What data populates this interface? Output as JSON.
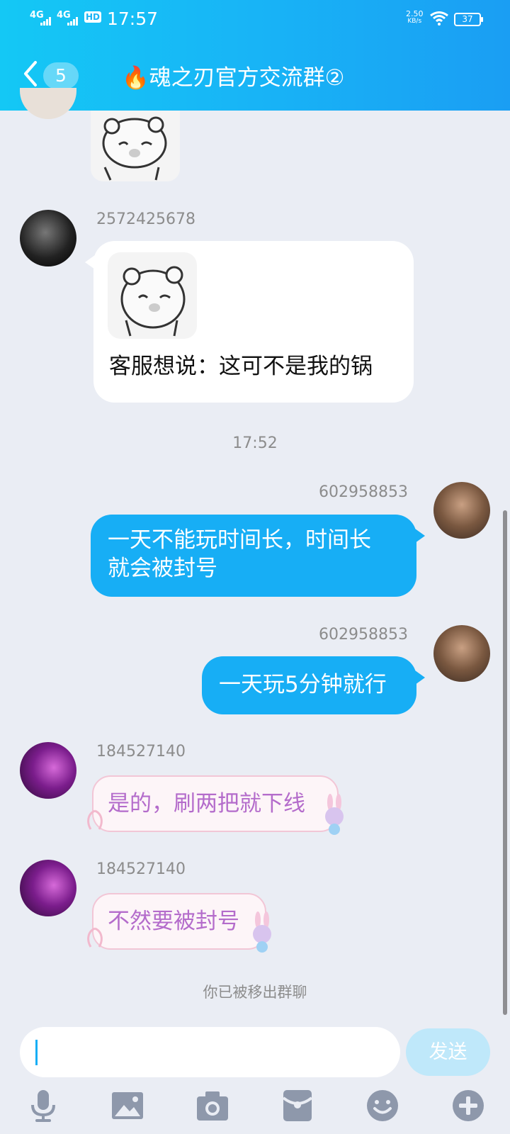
{
  "status_bar": {
    "signal1": "4G",
    "signal2": "4G",
    "hd": "HD",
    "time": "17:57",
    "net_speed": "2.50",
    "net_unit": "KB/s",
    "battery": "37"
  },
  "header": {
    "unread_count": "5",
    "title": "🔥魂之刃官方交流群②"
  },
  "messages": [
    {
      "sender": "2572425678",
      "text": "客服想说：这可不是我的锅"
    },
    {
      "timestamp": "17:52"
    },
    {
      "sender": "602958853",
      "text": "一天不能玩时间长，时间长就会被封号",
      "line1": "一天不能玩时间长，时间长",
      "line2": "就会被封号"
    },
    {
      "sender": "602958853",
      "text": "一天玩5分钟就行"
    },
    {
      "sender": "184527140",
      "text": "是的，刷两把就下线"
    },
    {
      "sender": "184527140",
      "text": "不然要被封号"
    }
  ],
  "system_notice": "你已被移出群聊",
  "input": {
    "send_label": "发送"
  },
  "toolbar": {
    "icons": [
      "microphone-icon",
      "image-icon",
      "camera-icon",
      "red-packet-icon",
      "emoji-icon",
      "plus-icon"
    ]
  },
  "colors": {
    "header_gradient_start": "#14c8f5",
    "header_gradient_end": "#1a9ef3",
    "own_bubble": "#17aef5",
    "background": "#eaedf4",
    "send_button": "#bfe8fa"
  }
}
